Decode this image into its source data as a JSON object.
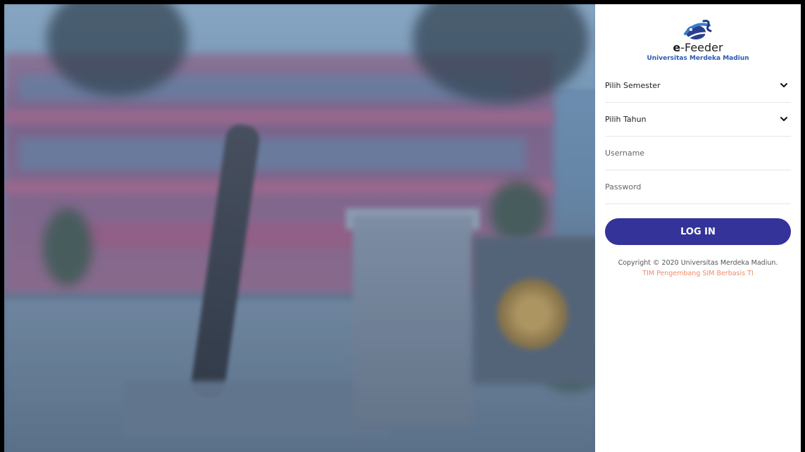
{
  "brand": {
    "name_prefix": "e",
    "name_rest": "-Feeder",
    "subtitle": "Universitas Merdeka Madiun",
    "logo_icon": "globe-swoosh-icon",
    "accent": "#2c5ab1"
  },
  "form": {
    "semester_select": {
      "selected": "Pilih Semester",
      "icon": "chevron-down-icon"
    },
    "year_select": {
      "selected": "Pilih Tahun",
      "icon": "chevron-down-icon"
    },
    "username": {
      "placeholder": "Username",
      "value": ""
    },
    "password": {
      "placeholder": "Password",
      "value": ""
    },
    "login_label": "LOG IN",
    "login_color": "#33339a"
  },
  "footer": {
    "copyright": "Copyright © 2020 Universitas Merdeka Madiun.",
    "team": "TIM Pengembang SIM Berbasis TI",
    "team_color": "#f08a6c"
  }
}
